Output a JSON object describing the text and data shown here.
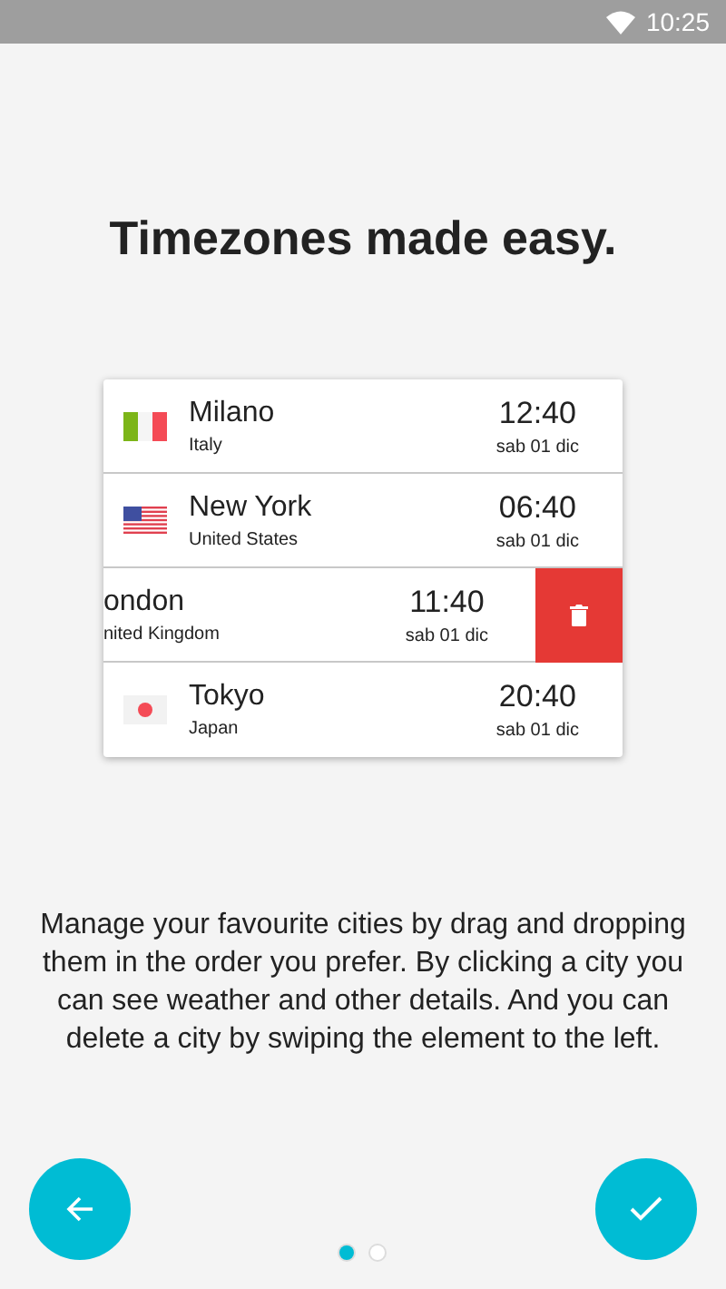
{
  "status_bar": {
    "time": "10:25"
  },
  "title": "Timezones made easy.",
  "cities": [
    {
      "kind": "italy",
      "swiped": false,
      "name": "Milano",
      "country": "Italy",
      "time": "12:40",
      "date": "sab 01 dic"
    },
    {
      "kind": "usa",
      "swiped": false,
      "name": "New York",
      "country": "United States",
      "time": "06:40",
      "date": "sab 01 dic"
    },
    {
      "swiped": true,
      "name": "ondon",
      "country": "nited Kingdom",
      "time": "11:40",
      "date": "sab 01 dic"
    },
    {
      "kind": "japan",
      "swiped": false,
      "name": "Tokyo",
      "country": "Japan",
      "time": "20:40",
      "date": "sab 01 dic"
    }
  ],
  "description": "Manage your favourite cities by drag and dropping them in the order you prefer. By clicking a city you can see weather and other details. And you can delete a city by swiping the element to the left.",
  "pages": [
    {
      "selected": true
    },
    {
      "selected": false
    }
  ]
}
